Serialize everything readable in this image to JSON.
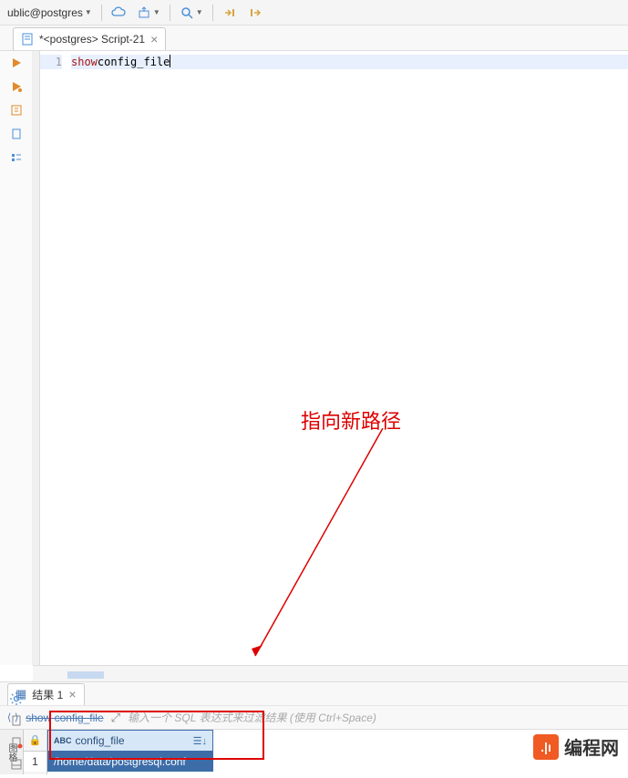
{
  "toolbar": {
    "breadcrumb": "ublic@postgres",
    "icons": [
      "cloud-icon",
      "export-icon",
      "search-icon",
      "step-in-icon",
      "step-out-icon"
    ]
  },
  "editor_tab": {
    "title": "*<postgres> Script-21",
    "icon": "sql-file-icon"
  },
  "code": {
    "line_number": "1",
    "keyword": "show",
    "identifier": " config_file"
  },
  "results_tab": {
    "title": "结果 1",
    "icon": "grid-icon"
  },
  "results_toolbar": {
    "sql_text": "show config_file",
    "filter_placeholder": "输入一个 SQL 表达式来过滤结果 (使用 Ctrl+Space)"
  },
  "grid": {
    "side_label": "图格",
    "row_number": "1",
    "column": {
      "type_badge": "ABC",
      "name": "config_file"
    },
    "cell_value": "/home/data/postgresql.conf"
  },
  "annotation": "指向新路径",
  "watermark": "编程网"
}
